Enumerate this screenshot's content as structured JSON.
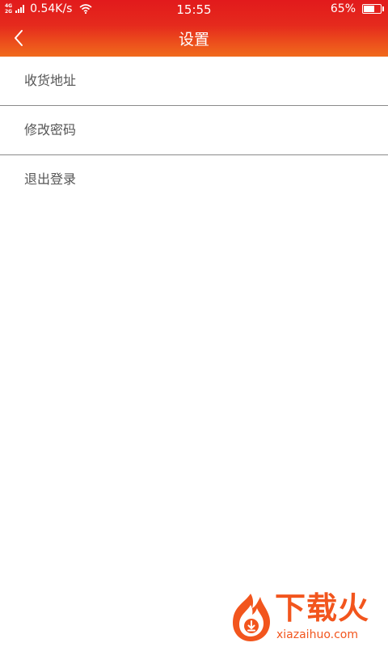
{
  "status_bar": {
    "network_top": "4G",
    "network_bottom": "2G",
    "speed": "0.54K/s",
    "time": "15:55",
    "battery_percent": "65%",
    "battery_level": 0.65
  },
  "header": {
    "title": "设置",
    "back_icon": "chevron-left-icon",
    "gradient_top": "#e21a1c",
    "gradient_bottom": "#f06a1c"
  },
  "menu": {
    "items": [
      {
        "label": "收货地址"
      },
      {
        "label": "修改密码"
      },
      {
        "label": "退出登录"
      }
    ]
  },
  "watermark": {
    "brand": "下载火",
    "site": "xiazaihuo.com",
    "icon": "flame-download-icon",
    "color": "#f2551d"
  }
}
